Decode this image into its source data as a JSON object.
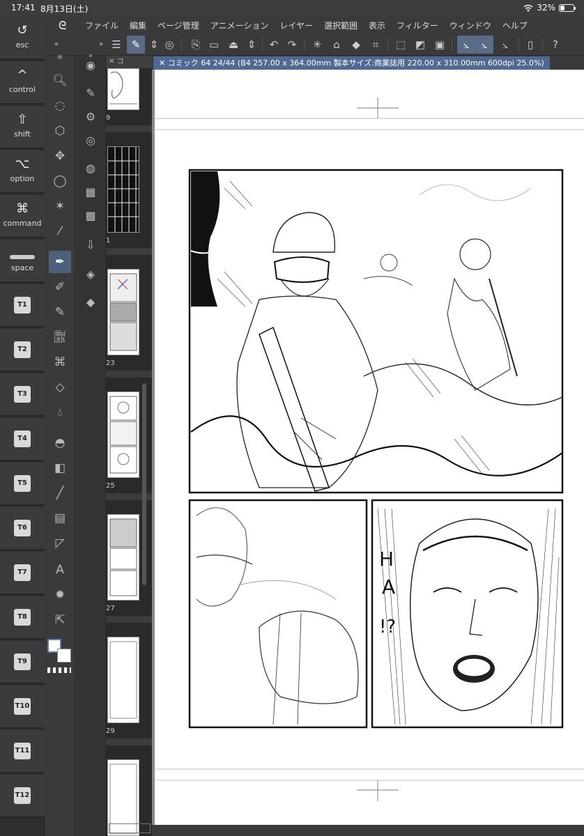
{
  "status": {
    "time": "17:41",
    "date": "8月13日(土)",
    "battery": "32%"
  },
  "modifiers": [
    {
      "icon": "↺",
      "label": "esc"
    },
    {
      "icon": "^",
      "label": "control"
    },
    {
      "icon": "⇧",
      "label": "shift"
    },
    {
      "icon": "⌥",
      "label": "option"
    },
    {
      "icon": "⌘",
      "label": "command"
    },
    {
      "icon": "",
      "label": "space"
    }
  ],
  "tkeys": [
    "T1",
    "T2",
    "T3",
    "T4",
    "T5",
    "T6",
    "T7",
    "T8",
    "T9",
    "T10",
    "T11",
    "T12"
  ],
  "menu": [
    "ファイル",
    "編集",
    "ページ管理",
    "アニメーション",
    "レイヤー",
    "選択範囲",
    "表示",
    "フィルター",
    "ウィンドウ",
    "ヘルプ"
  ],
  "pages_panel": {
    "header": "コ",
    "numbers": [
      "9",
      "1",
      "23",
      "25",
      "27",
      "29"
    ]
  },
  "canvas_tab": "コミック 64 24/44 (B4 257.00 x 364.00mm 製本サイズ:商業誌用 220.00 x 310.00mm 600dpi 25.0%)",
  "panel_text": {
    "sfx": [
      "H",
      "A",
      "!?"
    ]
  },
  "accent": "#4e6a93"
}
